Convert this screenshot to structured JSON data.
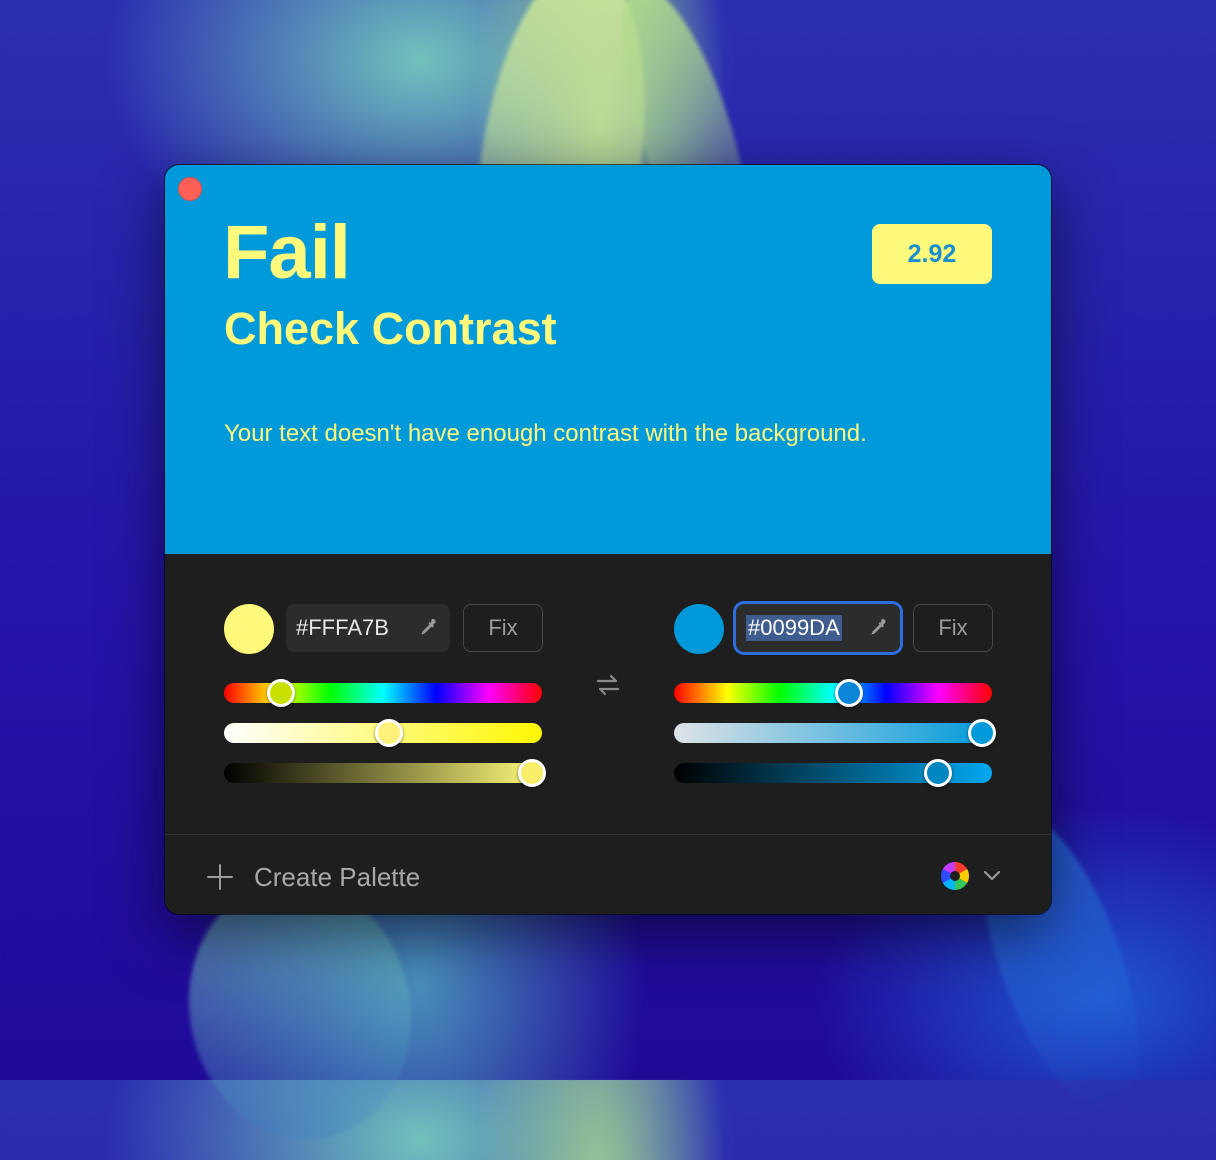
{
  "window": {
    "result": {
      "status": "Fail",
      "title": "Check Contrast",
      "ratio": "2.92",
      "message": "Your text doesn't have enough contrast with the background."
    },
    "foreground": {
      "hex": "#FFFA7B",
      "color": "#fffa7b",
      "fix_label": "Fix",
      "hue_level": 0.18,
      "saturation_level": 0.52,
      "brightness_level": 0.97
    },
    "background": {
      "hex": "#0099DA",
      "color": "#0099da",
      "fix_label": "Fix",
      "hue_level": 0.55,
      "saturation_level": 0.97,
      "brightness_level": 0.83
    },
    "footer": {
      "create_label": "Create Palette"
    }
  },
  "colors": {
    "accent_focus": "#2d6dde",
    "close_button": "#ff5f57",
    "panel_dark": "#1e1e1e"
  },
  "icons": [
    "close-icon",
    "eyedropper-icon",
    "swap-icon",
    "plus-icon",
    "color-wheel-icon",
    "chevron-down-icon"
  ]
}
